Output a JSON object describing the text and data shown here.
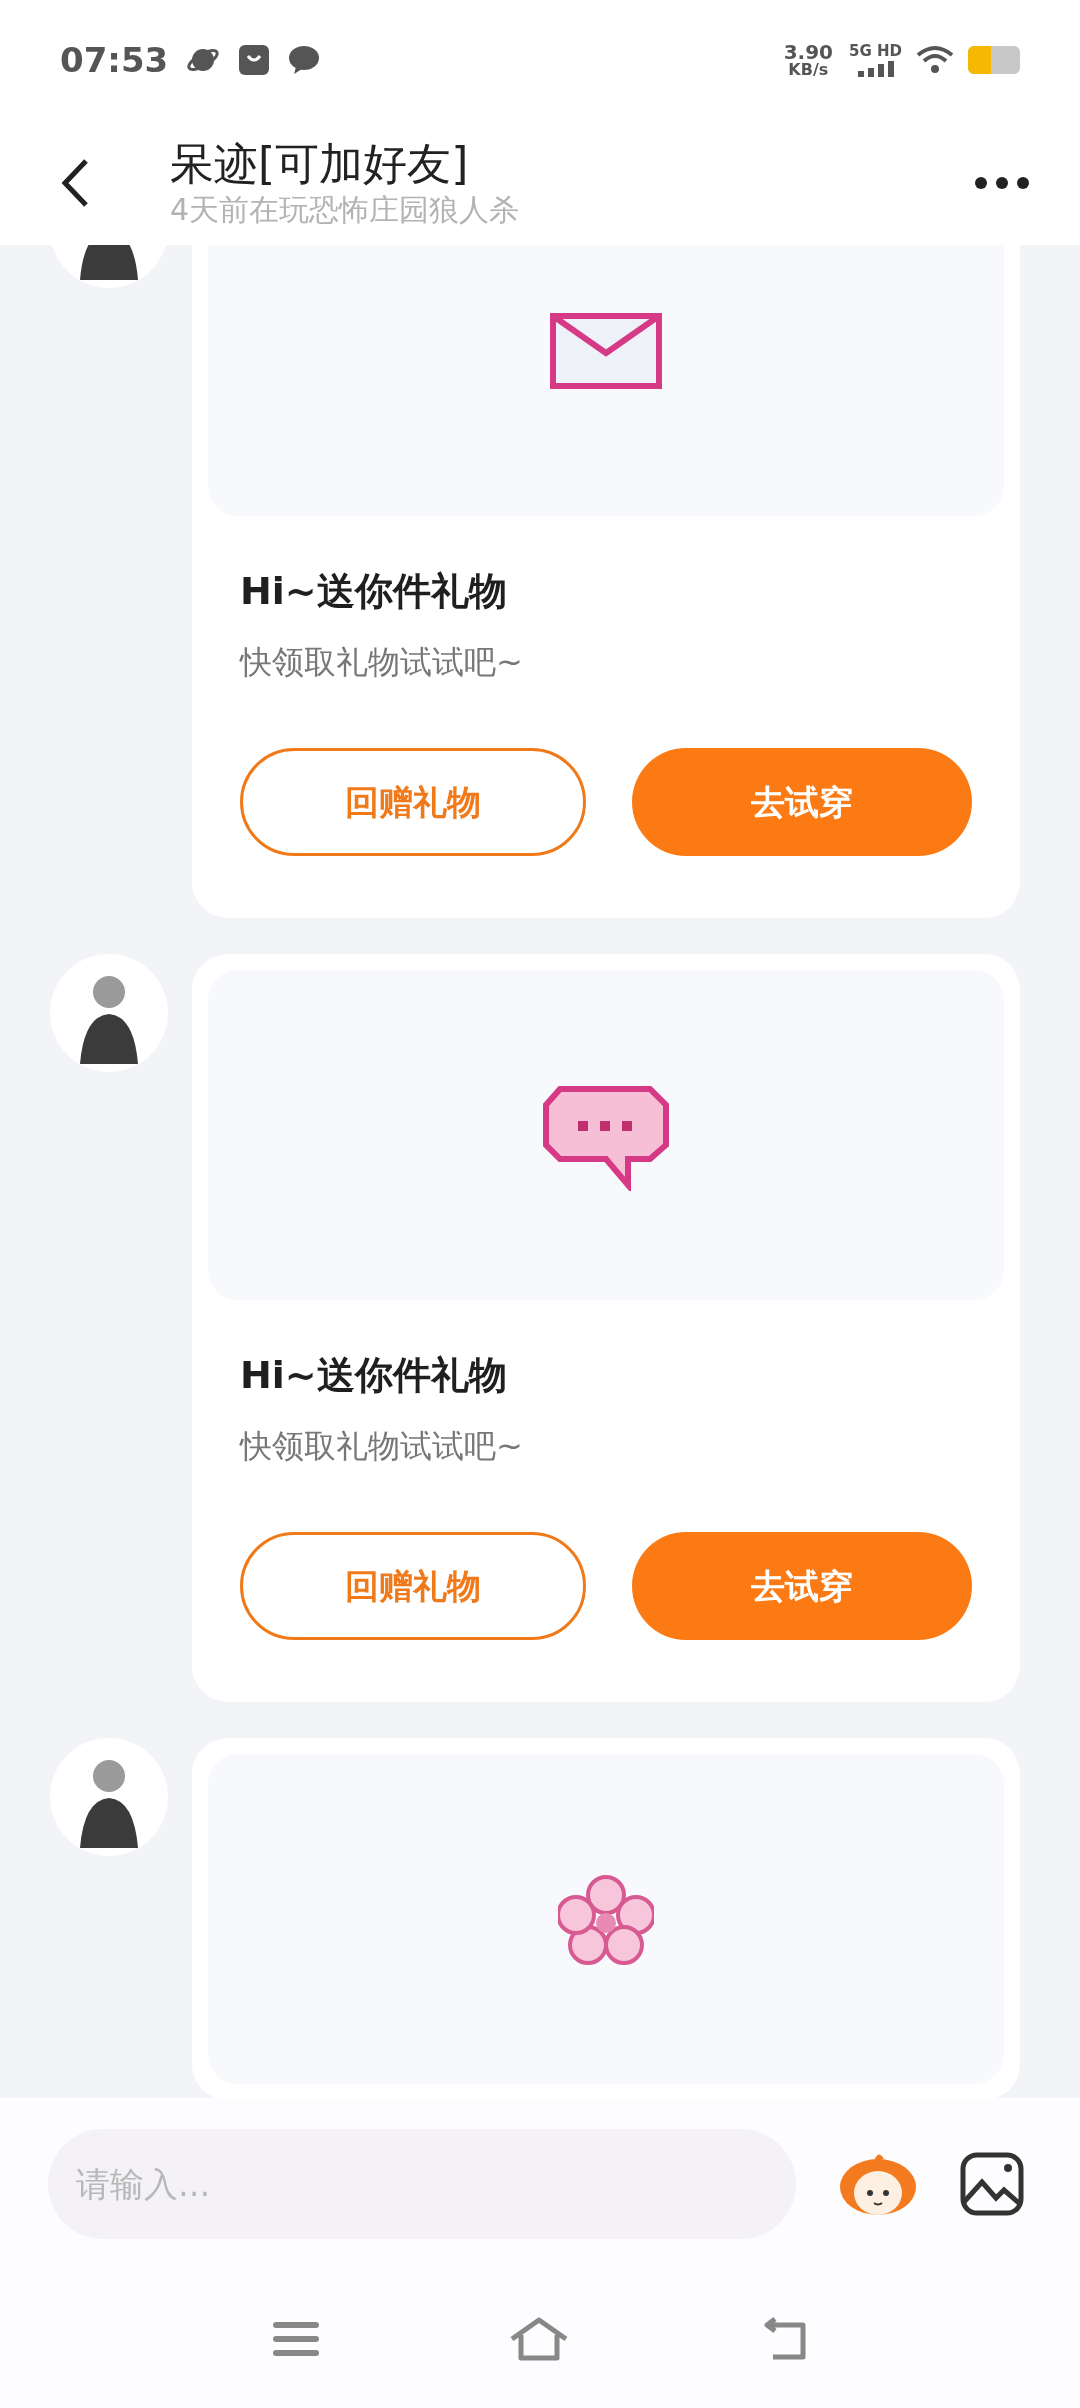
{
  "status_bar": {
    "time": "07:53",
    "speed": "3.90",
    "speed_unit": "KB/s",
    "network": "5G HD"
  },
  "header": {
    "title": "呆迹[可加好友]",
    "subtitle": "4天前在玩恐怖庄园狼人杀"
  },
  "messages": [
    {
      "kind": "envelope",
      "title": "Hi~送你件礼物",
      "subtitle": "快领取礼物试试吧~",
      "buttons": [
        {
          "label": "回赠礼物",
          "kind": "outline"
        },
        {
          "label": "去试穿",
          "kind": "filled"
        }
      ]
    },
    {
      "kind": "chat",
      "title": "Hi~送你件礼物",
      "subtitle": "快领取礼物试试吧~",
      "buttons": [
        {
          "label": "回赠礼物",
          "kind": "outline"
        },
        {
          "label": "去试穿",
          "kind": "filled"
        }
      ]
    },
    {
      "kind": "flower"
    }
  ],
  "input": {
    "placeholder": "请输入..."
  }
}
